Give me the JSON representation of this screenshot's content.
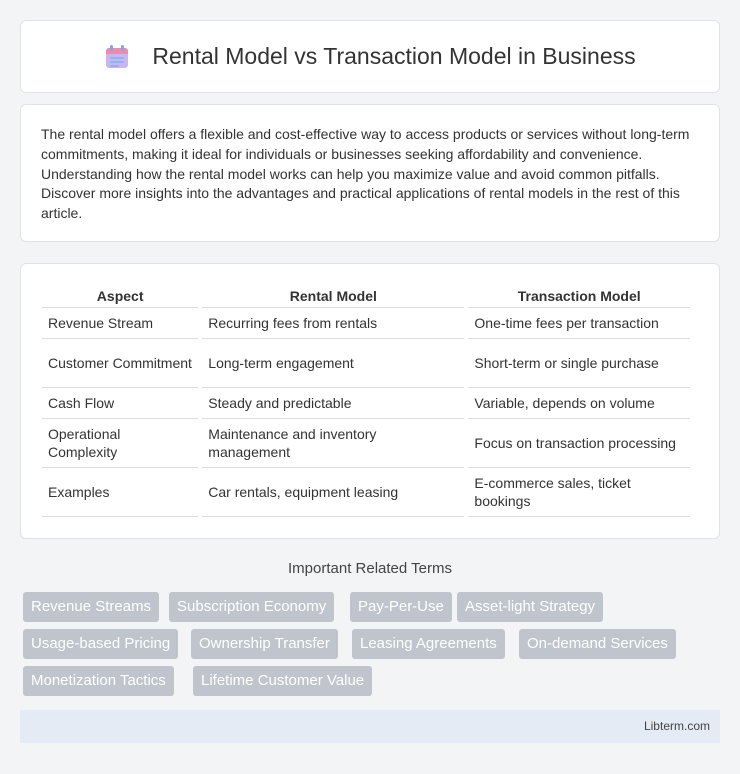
{
  "header": {
    "title": "Rental Model vs Transaction Model in Business",
    "icon": "calendar-icon"
  },
  "intro": {
    "text": "The rental model offers a flexible and cost-effective way to access products or services without long-term commitments, making it ideal for individuals or businesses seeking affordability and convenience. Understanding how the rental model works can help you maximize value and avoid common pitfalls. Discover more insights into the advantages and practical applications of rental models in the rest of this article."
  },
  "table": {
    "headers": [
      "Aspect",
      "Rental Model",
      "Transaction Model"
    ],
    "rows": [
      [
        "Revenue Stream",
        "Recurring fees from rentals",
        "One-time fees per transaction"
      ],
      [
        "Customer Commitment",
        "Long-term engagement",
        "Short-term or single purchase"
      ],
      [
        "Cash Flow",
        "Steady and predictable",
        "Variable, depends on volume"
      ],
      [
        "Operational Complexity",
        "Maintenance and inventory management",
        "Focus on transaction processing"
      ],
      [
        "Examples",
        "Car rentals, equipment leasing",
        "E-commerce sales, ticket bookings"
      ]
    ]
  },
  "related": {
    "title": "Important Related Terms",
    "tags": [
      "Revenue Streams",
      "Subscription Economy",
      "Pay-Per-Use",
      "Asset-light Strategy",
      "Usage-based Pricing",
      "Ownership Transfer",
      "Leasing Agreements",
      "On-demand Services",
      "Monetization Tactics",
      "Lifetime Customer Value"
    ]
  },
  "footer": {
    "text": "Libterm.com"
  },
  "colors": {
    "tag_bg": "#bfc4cd",
    "footer_bg": "#e5ebf5",
    "page_bg": "#f3f4f6"
  }
}
